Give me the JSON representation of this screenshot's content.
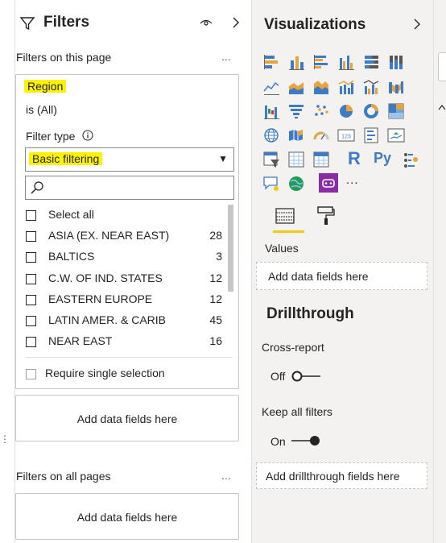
{
  "filters_pane": {
    "title": "Filters",
    "page_section_label": "Filters on this page",
    "more": "...",
    "region_card": {
      "field_name": "Region",
      "summary": "is (All)",
      "filter_type_label": "Filter type",
      "filter_type_value": "Basic filtering",
      "search_placeholder": "",
      "items": [
        {
          "label": "Select all",
          "count": ""
        },
        {
          "label": "ASIA (EX. NEAR EAST)",
          "count": "28"
        },
        {
          "label": "BALTICS",
          "count": "3"
        },
        {
          "label": "C.W. OF IND. STATES",
          "count": "12"
        },
        {
          "label": "EASTERN EUROPE",
          "count": "12"
        },
        {
          "label": "LATIN AMER. & CARIB",
          "count": "45"
        },
        {
          "label": "NEAR EAST",
          "count": "16"
        }
      ],
      "require_single": "Require single selection"
    },
    "add_fields_page": "Add data fields here",
    "all_pages_label": "Filters on all pages",
    "add_fields_all": "Add data fields here"
  },
  "viz_pane": {
    "title": "Visualizations",
    "more_visuals": "...",
    "values_label": "Values",
    "values_placeholder": "Add data fields here",
    "drillthrough_title": "Drillthrough",
    "cross_report_label": "Cross-report",
    "cross_report_state": "Off",
    "keep_filters_label": "Keep all filters",
    "keep_filters_state": "On",
    "drillthrough_placeholder": "Add drillthrough fields here",
    "icon_r": "R",
    "icon_py": "Py",
    "icon_123": "123"
  },
  "colors": {
    "accent": "#f2c811",
    "highlight": "#fff200",
    "viz_blue": "#3d7bc4",
    "viz_orange": "#e8a33d"
  }
}
